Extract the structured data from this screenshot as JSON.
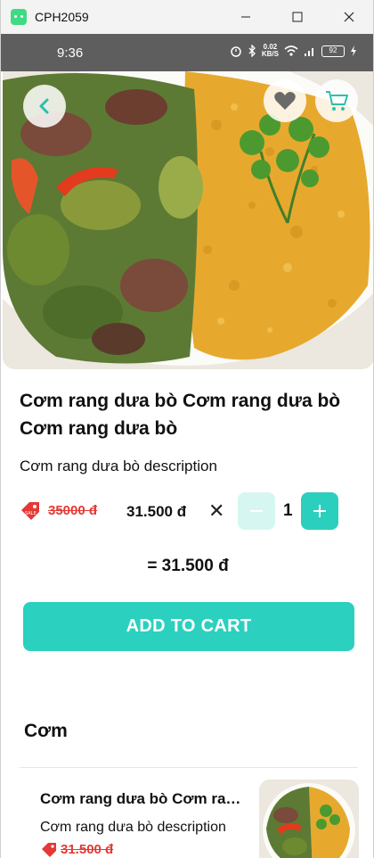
{
  "window": {
    "title": "CPH2059"
  },
  "status_bar": {
    "time": "9:36",
    "net_speed_top": "0.02",
    "net_speed_unit": "KB/S",
    "battery": "92"
  },
  "hero": {
    "back_icon": "chevron-left-icon",
    "favorite_icon": "heart-icon",
    "cart_icon": "cart-icon"
  },
  "product": {
    "title": "Cơm rang dưa bò Cơm rang dưa bò Cơm rang dưa bò",
    "description": "Cơm rang dưa bò description",
    "old_price": "35000 đ",
    "price": "31.500 đ",
    "times": "✕",
    "quantity": "1",
    "total": "= 31.500 đ"
  },
  "actions": {
    "add_to_cart": "ADD TO CART"
  },
  "related": {
    "section_title": "Cơm",
    "items": [
      {
        "title": "Cơm rang dưa bò Cơm rang dưa bò Cơm rang dưa bò",
        "description": "Cơm rang dưa bò description",
        "old_price": "31.500 đ"
      }
    ]
  },
  "colors": {
    "accent": "#2bd0bf",
    "accent_light": "#d6f6f1",
    "sale": "#e53935",
    "status_bar": "#5e5e5e"
  }
}
